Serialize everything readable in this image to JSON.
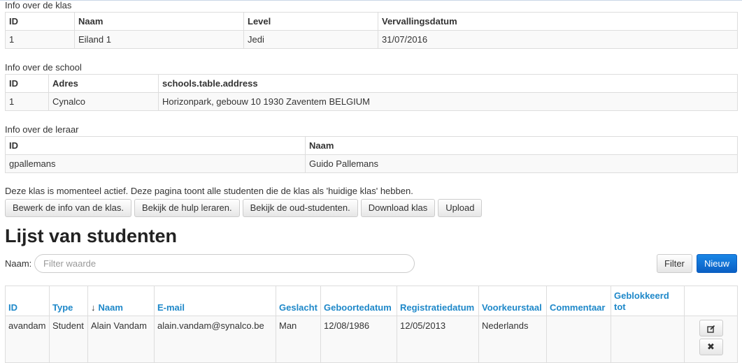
{
  "class_info": {
    "caption": "Info over de klas",
    "headers": [
      "ID",
      "Naam",
      "Level",
      "Vervallingsdatum"
    ],
    "row": [
      "1",
      "Eiland 1",
      "Jedi",
      "31/07/2016"
    ]
  },
  "school_info": {
    "caption": "Info over de school",
    "headers": [
      "ID",
      "Adres",
      "schools.table.address"
    ],
    "row": [
      "1",
      "Cynalco",
      "Horizonpark, gebouw 10 1930 Zaventem BELGIUM"
    ]
  },
  "teacher_info": {
    "caption": "Info over de leraar",
    "headers": [
      "ID",
      "Naam"
    ],
    "row": [
      "gpallemans",
      "Guido Pallemans"
    ]
  },
  "notice": "Deze klas is momenteel actief. Deze pagina toont alle studenten die de klas als 'huidige klas' hebben.",
  "buttons": {
    "edit_info": "Bewerk de info van de klas.",
    "help_teachers": "Bekijk de hulp leraren.",
    "old_students": "Bekijk de oud-studenten.",
    "download": "Download klas",
    "upload": "Upload"
  },
  "students": {
    "title": "Lijst van studenten",
    "filter_label": "Naam:",
    "filter_placeholder": "Filter waarde",
    "filter_button": "Filter",
    "new_button": "Nieuw",
    "columns": [
      "ID",
      "Type",
      "Naam",
      "E-mail",
      "Geslacht",
      "Geboortedatum",
      "Registratiedatum",
      "Voorkeurstaal",
      "Commentaar",
      "Geblokkeerd tot"
    ],
    "sort_icon": "arrow-down-icon",
    "rows": [
      {
        "id": "avandam",
        "type": "Student",
        "name": "Alain Vandam",
        "email": "alain.vandam@synalco.be",
        "gender": "Man",
        "birthdate": "12/08/1986",
        "registration": "12/05/2013",
        "language": "Nederlands",
        "comment": "",
        "blocked_until": ""
      }
    ],
    "row_actions": [
      "edit-icon",
      "delete-icon"
    ]
  },
  "colors": {
    "link_header": "#1e88c9",
    "primary_button": "#0a5fc4"
  }
}
